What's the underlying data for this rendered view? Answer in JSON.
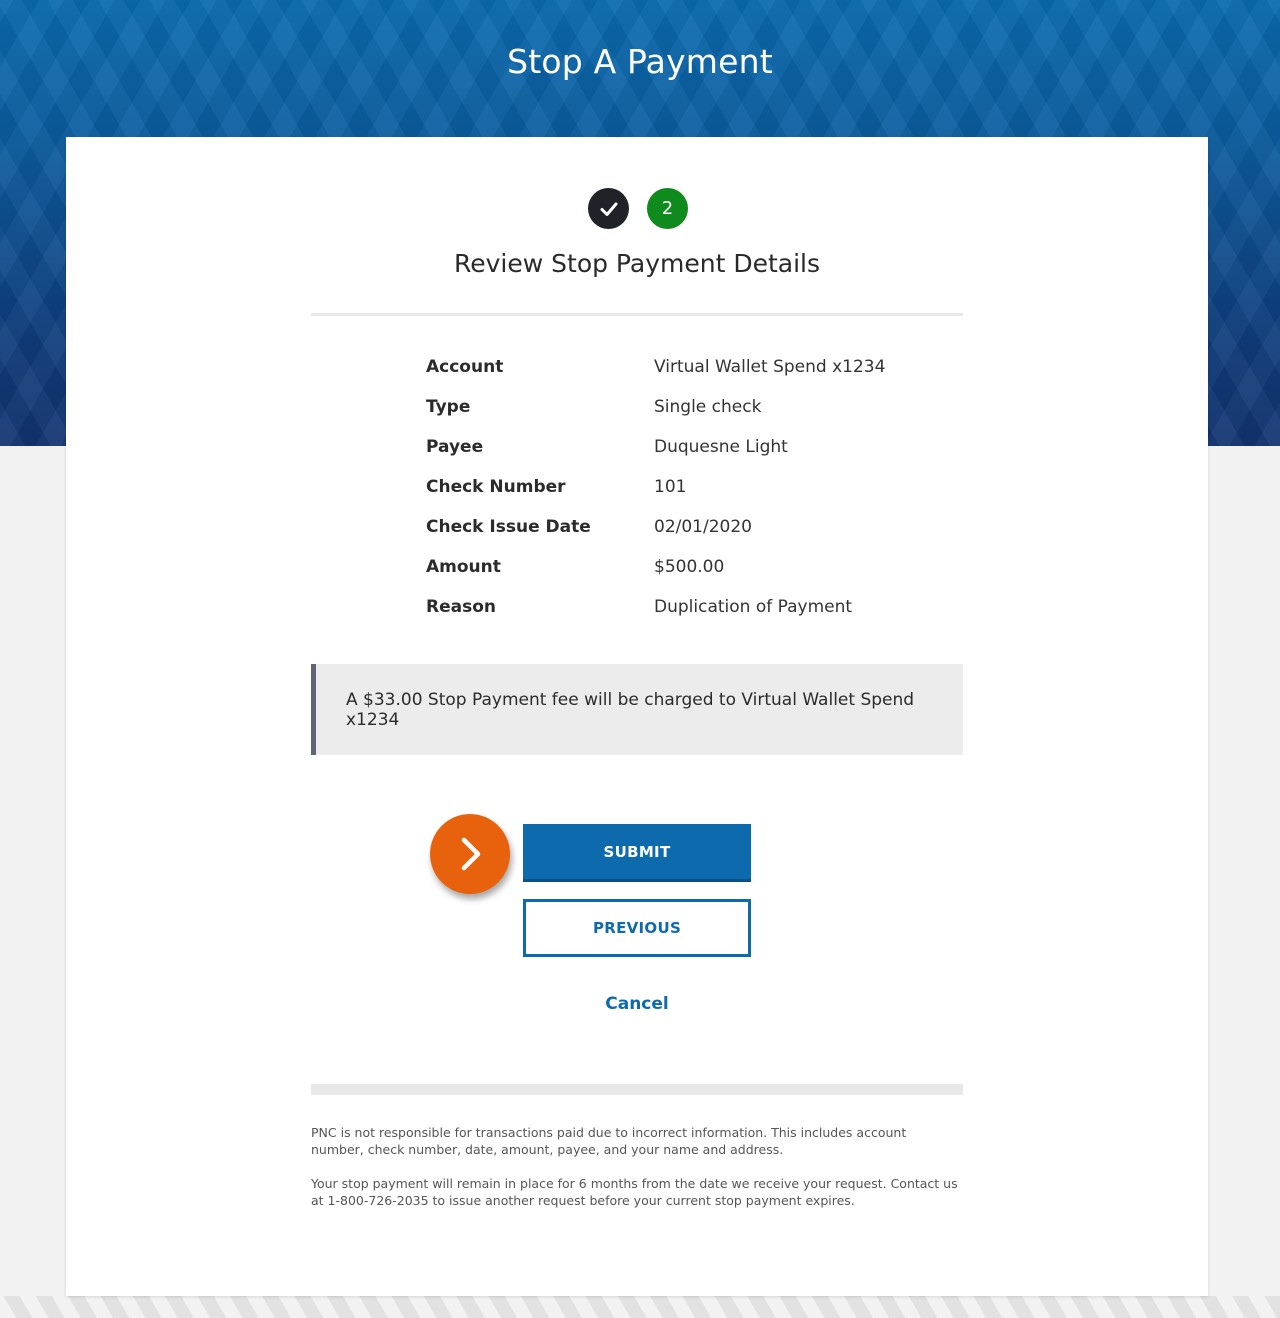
{
  "header": {
    "title": "Stop A Payment"
  },
  "steps": {
    "step1_state": "completed",
    "step2_number": "2"
  },
  "review": {
    "title": "Review Stop Payment Details",
    "details": [
      {
        "label": "Account",
        "value": "Virtual Wallet Spend x1234"
      },
      {
        "label": "Type",
        "value": "Single check"
      },
      {
        "label": "Payee",
        "value": "Duquesne Light"
      },
      {
        "label": "Check Number",
        "value": "101"
      },
      {
        "label": "Check Issue Date",
        "value": "02/01/2020"
      },
      {
        "label": "Amount",
        "value": "$500.00"
      },
      {
        "label": "Reason",
        "value": "Duplication of Payment"
      }
    ],
    "fee_notice": "A $33.00 Stop Payment fee will be charged to Virtual Wallet Spend x1234"
  },
  "actions": {
    "submit_label": "SUBMIT",
    "previous_label": "PREVIOUS",
    "cancel_label": "Cancel"
  },
  "disclaimers": [
    "PNC is not responsible for transactions paid due to incorrect information. This includes account number, check number, date, amount, payee, and your name and address.",
    "Your stop payment will remain in place for 6 months from the date we receive your request. Contact us at 1-800-726-2035 to issue another request before your current stop payment expires."
  ],
  "colors": {
    "brand_blue": "#0d6aad",
    "step_complete": "#1f2328",
    "step_active": "#0f8a1c",
    "pointer_orange": "#e8620e"
  },
  "icons": {
    "step1": "checkmark-icon",
    "pointer": "chevron-right-icon"
  }
}
